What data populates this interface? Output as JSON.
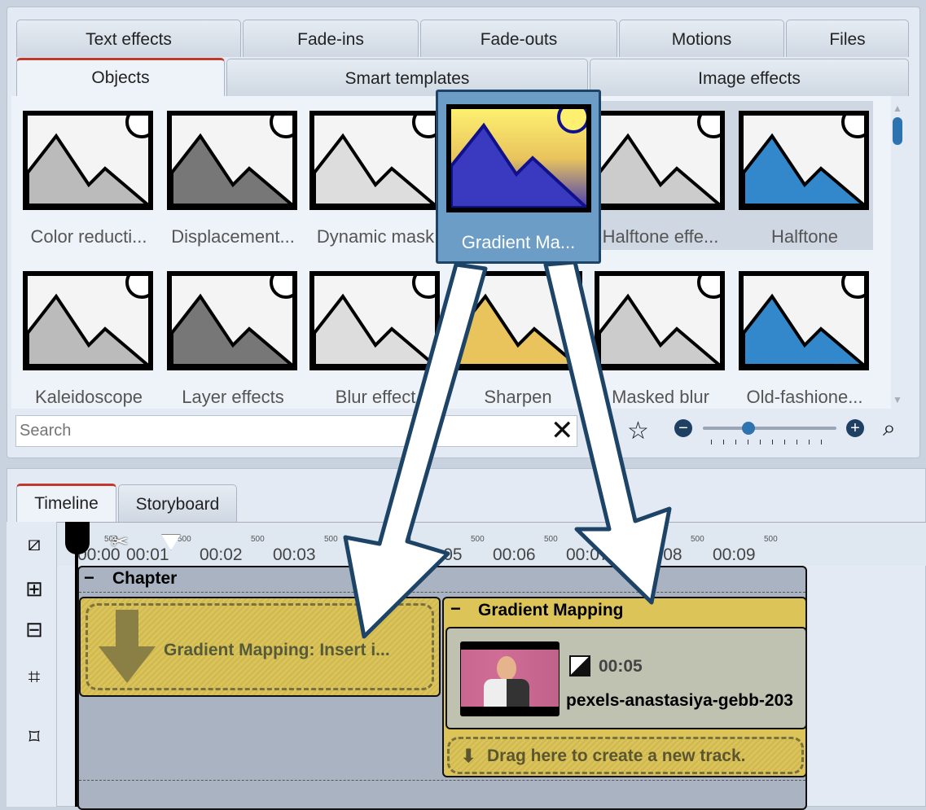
{
  "tabs_row1": [
    "Text effects",
    "Fade-ins",
    "Fade-outs",
    "Motions",
    "Files"
  ],
  "tabs_row2": [
    "Objects",
    "Smart templates",
    "Image effects"
  ],
  "effects": [
    "Color reducti...",
    "Displacement...",
    "Dynamic mask",
    "Gradient Ma...",
    "Halftone effe...",
    "Halftone",
    "Kaleidoscope",
    "Layer effects",
    "Blur effect",
    "Sharpen",
    "Masked blur",
    "Old-fashione..."
  ],
  "selected_effect": "Gradient Ma...",
  "search": {
    "placeholder": "Search"
  },
  "zoom_slider": 0.3,
  "bottom_tabs": [
    "Timeline",
    "Storyboard"
  ],
  "ruler": {
    "ticks": [
      "500",
      "500",
      "500",
      "500",
      "500",
      "500",
      "500",
      "500",
      "500",
      "500"
    ],
    "times": [
      "00:00",
      "00:01",
      "00:02",
      "00:03",
      "00:05",
      "00:06",
      "00:07",
      "00:08",
      "00:09"
    ]
  },
  "chapter": {
    "title": "Chapter",
    "drop_label": "Gradient Mapping: Insert i..."
  },
  "track": {
    "title": "Gradient Mapping",
    "duration": "00:05",
    "filename": "pexels-anastasiya-gebb-203",
    "new_track": "Drag here to create a new track."
  },
  "colors": {
    "accent": "#c0392b",
    "selected": "#6b9dc6",
    "track": "#dcc458"
  }
}
